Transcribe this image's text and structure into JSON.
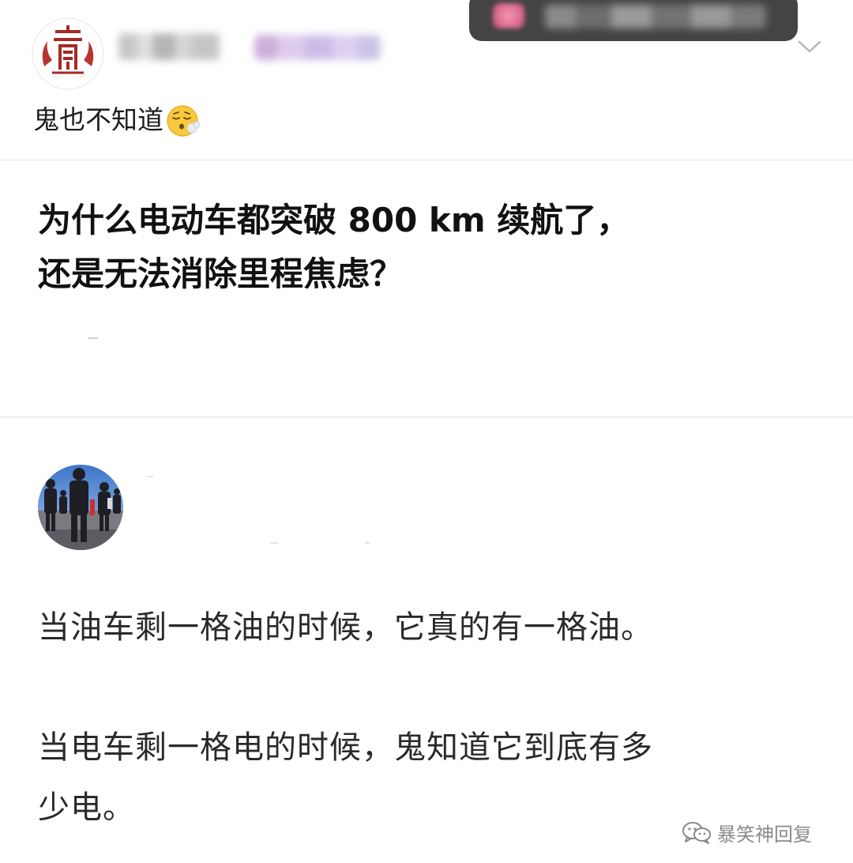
{
  "post": {
    "text": "鬼也不知道",
    "emoji": "exhaling-face-emoji"
  },
  "question": {
    "title_line1": "为什么电动车都突破 800 km 续航了，",
    "title_line2": "还是无法消除里程焦虑？"
  },
  "answer": {
    "paragraph1": "当油车剩一格油的时候，它真的有一格油。",
    "paragraph2_line1": "当电车剩一格电的时候，鬼知道它到底有多",
    "paragraph2_line2": "少电。"
  },
  "watermark": {
    "text": "暴笑神回复",
    "icon": "wechat-icon"
  },
  "colors": {
    "background": "#f4f4f4",
    "card": "#ffffff",
    "toast": "#444444",
    "seal_red": "#a52a24"
  }
}
